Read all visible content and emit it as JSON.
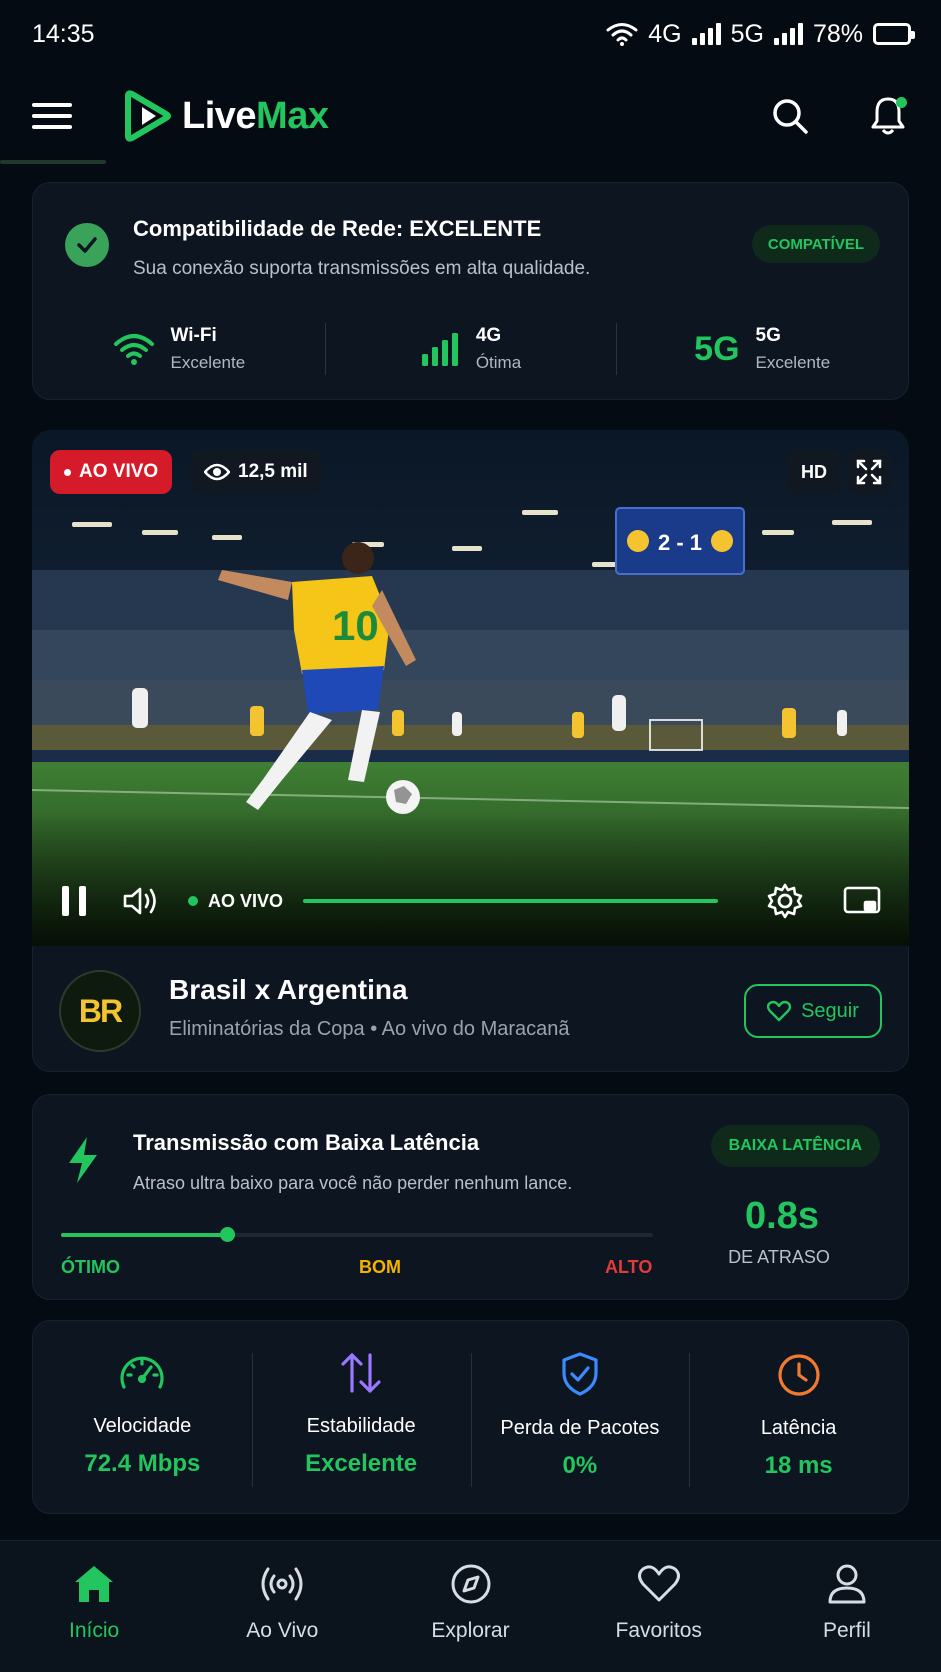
{
  "status_bar": {
    "time": "14:35",
    "net1": "4G",
    "net2": "5G",
    "battery": "78%"
  },
  "app": {
    "logo_live": "Live",
    "logo_max": "Max"
  },
  "network_card": {
    "title": "Compatibilidade de Rede: EXCELENTE",
    "subtitle": "Sua conexão suporta transmissões em alta qualidade.",
    "badge": "COMPATÍVEL",
    "items": [
      {
        "icon": "wifi-icon",
        "name": "Wi-Fi",
        "quality": "Excelente"
      },
      {
        "icon": "signal-bars-icon",
        "name": "4G",
        "quality": "Ótima"
      },
      {
        "icon": "5g-icon",
        "glyph": "5G",
        "name": "5G",
        "quality": "Excelente"
      }
    ]
  },
  "player": {
    "live_badge": "AO VIVO",
    "viewers": "12,5 mil",
    "quality": "HD",
    "live_indicator": "AO VIVO",
    "scoreboard": "2 - 1",
    "jersey_number": "10",
    "progress": 1.0
  },
  "match": {
    "logo_text": "BR",
    "title": "Brasil x Argentina",
    "subtitle": "Eliminatórias da Copa • Ao vivo do Maracanã",
    "follow_label": "Seguir"
  },
  "latency_card": {
    "title": "Transmissão com Baixa Latência",
    "subtitle": "Atraso ultra baixo para você não perder nenhum lance.",
    "badge": "BAIXA LATÊNCIA",
    "level_fraction": 0.28,
    "labels": {
      "good": "ÓTIMO",
      "mid": "BOM",
      "high": "ALTO"
    },
    "value": "0.8s",
    "value_caption": "DE ATRASO",
    "colors": {
      "good": "#22c55e",
      "mid": "#f5b301",
      "high": "#e23b3b"
    }
  },
  "stats": [
    {
      "icon": "speedometer-icon",
      "label": "Velocidade",
      "value": "72.4 Mbps"
    },
    {
      "icon": "arrows-updown-icon",
      "label": "Estabilidade",
      "value": "Excelente"
    },
    {
      "icon": "shield-check-icon",
      "label": "Perda de Pacotes",
      "value": "0%"
    },
    {
      "icon": "clock-icon",
      "label": "Latência",
      "value": "18 ms"
    }
  ],
  "nav": [
    {
      "icon": "home-icon",
      "label": "Início",
      "active": true
    },
    {
      "icon": "broadcast-icon",
      "label": "Ao Vivo"
    },
    {
      "icon": "compass-icon",
      "label": "Explorar"
    },
    {
      "icon": "heart-icon",
      "label": "Favoritos"
    },
    {
      "icon": "user-icon",
      "label": "Perfil"
    }
  ],
  "colors": {
    "accent": "#22c55e",
    "live_red": "#d51b2a",
    "background": "#050b13",
    "card": "#0c1520"
  }
}
